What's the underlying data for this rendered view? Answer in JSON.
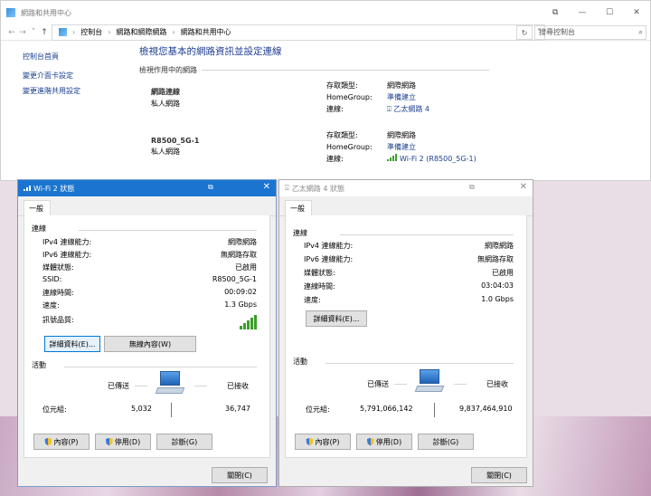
{
  "main": {
    "title": "網路和共用中心",
    "nav": {
      "back": "←",
      "forward": "→",
      "up": "↑"
    },
    "breadcrumb": [
      "控制台",
      "網路和網際網路",
      "網路和共用中心"
    ],
    "search_placeholder": "搜尋控制台",
    "left_links": [
      "控制台首頁",
      "變更介面卡設定",
      "變更進階共用設定"
    ],
    "heading": "檢視您基本的網路資訊並設定連線",
    "active_networks_label": "檢視作用中的網路",
    "networks": [
      {
        "name": "網路連線",
        "type": "私人網路",
        "access_label": "存取類型:",
        "access": "網際網路",
        "homegroup_label": "HomeGroup:",
        "homegroup": "準備建立",
        "conn_label": "連線:",
        "conn": "乙太網路 4"
      },
      {
        "name": "R8500_5G-1",
        "type": "私人網路",
        "access_label": "存取類型:",
        "access": "網際網路",
        "homegroup_label": "HomeGroup:",
        "homegroup": "準備建立",
        "conn_label": "連線:",
        "conn": "Wi-Fi 2 (R8500_5G-1)"
      }
    ]
  },
  "wifi_dialog": {
    "title": "Wi-Fi 2 狀態",
    "tab": "一般",
    "conn_section": "連線",
    "rows": [
      {
        "label": "IPv4 連線能力:",
        "value": "網際網路"
      },
      {
        "label": "IPv6 連線能力:",
        "value": "無網路存取"
      },
      {
        "label": "媒體狀態:",
        "value": "已啟用"
      },
      {
        "label": "SSID:",
        "value": "R8500_5G-1"
      },
      {
        "label": "連線時間:",
        "value": "00:09:02"
      },
      {
        "label": "速度:",
        "value": "1.3 Gbps"
      }
    ],
    "signal_label": "訊號品質:",
    "details_button": "詳細資料(E)...",
    "wireless_button": "無線內容(W)",
    "activity_section": "活動",
    "sent_label": "已傳送",
    "received_label": "已接收",
    "bytes_label": "位元組:",
    "sent_bytes": "5,032",
    "received_bytes": "36,747",
    "props_button": "內容(P)",
    "disable_button": "停用(D)",
    "diagnose_button": "診斷(G)",
    "close_button": "關閉(C)"
  },
  "eth_dialog": {
    "title": "乙太網路 4 狀態",
    "tab": "一般",
    "conn_section": "連線",
    "rows": [
      {
        "label": "IPv4 連線能力:",
        "value": "網際網路"
      },
      {
        "label": "IPv6 連線能力:",
        "value": "無網路存取"
      },
      {
        "label": "媒體狀態:",
        "value": "已啟用"
      },
      {
        "label": "連線時間:",
        "value": "03:04:03"
      },
      {
        "label": "速度:",
        "value": "1.0 Gbps"
      }
    ],
    "details_button": "詳細資料(E)...",
    "activity_section": "活動",
    "sent_label": "已傳送",
    "received_label": "已接收",
    "bytes_label": "位元組:",
    "sent_bytes": "5,791,066,142",
    "received_bytes": "9,837,464,910",
    "props_button": "內容(P)",
    "disable_button": "停用(D)",
    "diagnose_button": "診斷(G)",
    "close_button": "關閉(C)"
  }
}
